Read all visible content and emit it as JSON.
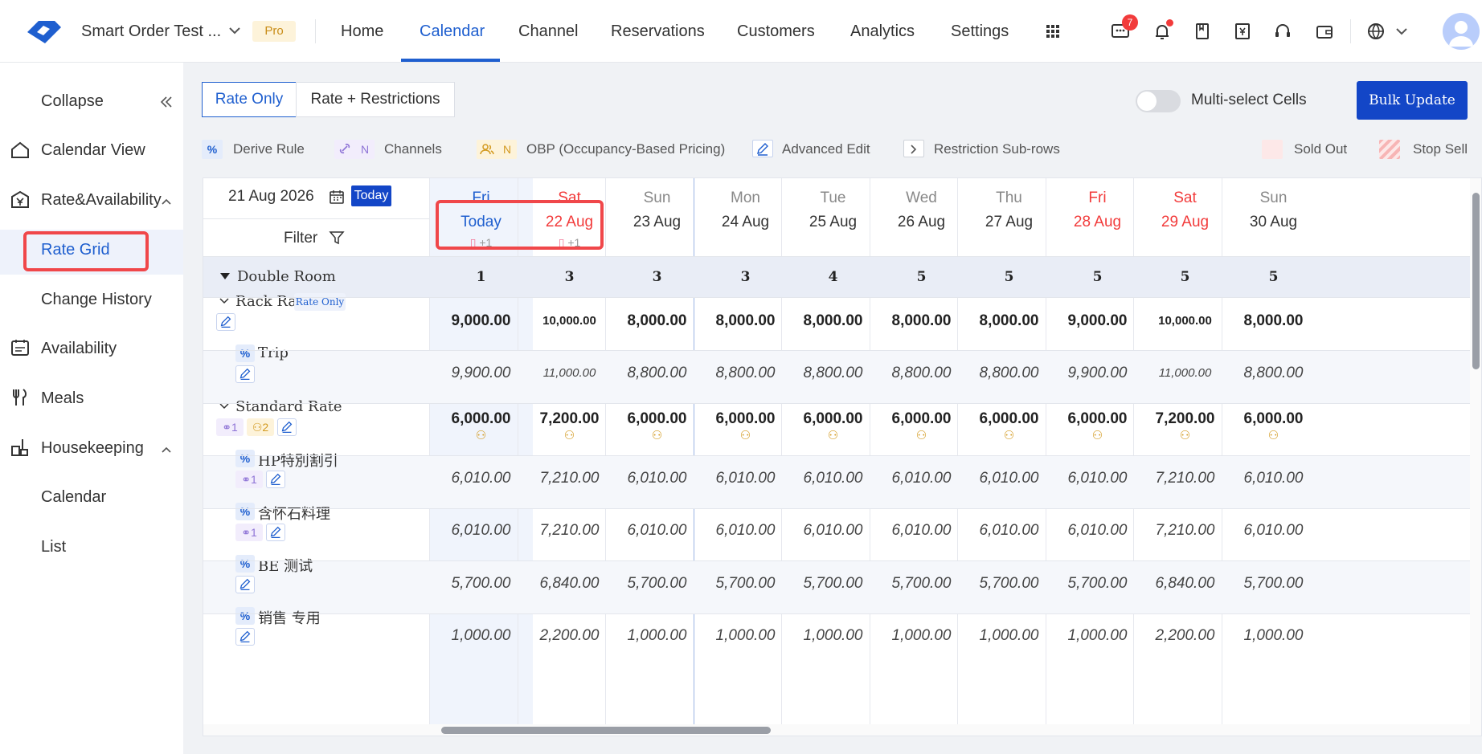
{
  "header": {
    "brand": "Smart Order Test ...",
    "badge": "Pro",
    "nav": [
      "Home",
      "Calendar",
      "Channel",
      "Reservations",
      "Customers",
      "Analytics",
      "Settings"
    ],
    "active_nav": "Calendar",
    "notification_count": "7",
    "accent": "#1f5fcf"
  },
  "sidebar": {
    "collapse": "Collapse",
    "calendar_view": "Calendar View",
    "rate_availability": "Rate&Availability",
    "rate_grid": "Rate Grid",
    "change_history": "Change History",
    "availability": "Availability",
    "meals": "Meals",
    "housekeeping": "Housekeeping",
    "hk_calendar": "Calendar",
    "hk_list": "List"
  },
  "toolbar": {
    "rate_only": "Rate Only",
    "rate_restrictions": "Rate + Restrictions",
    "multi_select": "Multi-select Cells",
    "bulk_update": "Bulk Update"
  },
  "legend": {
    "derive": "Derive Rule",
    "channels": "Channels",
    "obp": "OBP (Occupancy-Based Pricing)",
    "advanced": "Advanced Edit",
    "restriction": "Restriction Sub-rows",
    "sold_out": "Sold Out",
    "stop_sell": "Stop Sell",
    "pct": "%",
    "n": "N"
  },
  "grid_controls": {
    "date": "21 Aug 2026",
    "today": "Today",
    "filter": "Filter"
  },
  "days": [
    {
      "name": "Fri",
      "date": "Today",
      "extra": "+1"
    },
    {
      "name": "Sat",
      "date": "22 Aug",
      "extra": "+1"
    },
    {
      "name": "Sun",
      "date": "23 Aug"
    },
    {
      "name": "Mon",
      "date": "24 Aug"
    },
    {
      "name": "Tue",
      "date": "25 Aug"
    },
    {
      "name": "Wed",
      "date": "26 Aug"
    },
    {
      "name": "Thu",
      "date": "27 Aug"
    },
    {
      "name": "Fri",
      "date": "28 Aug"
    },
    {
      "name": "Sat",
      "date": "29 Aug"
    },
    {
      "name": "Sun",
      "date": "30 Aug"
    }
  ],
  "room": {
    "name": "Double Room",
    "counts": [
      "1",
      "3",
      "3",
      "3",
      "4",
      "5",
      "5",
      "5",
      "5",
      "5"
    ]
  },
  "rows": {
    "rack": {
      "name": "Rack Rate",
      "tag": "Rate Only",
      "values": [
        "9,000.00",
        "10,000.00",
        "8,000.00",
        "8,000.00",
        "8,000.00",
        "8,000.00",
        "8,000.00",
        "9,000.00",
        "10,000.00",
        "8,000.00"
      ]
    },
    "trip": {
      "name": "Trip",
      "values": [
        "9,900.00",
        "11,000.00",
        "8,800.00",
        "8,800.00",
        "8,800.00",
        "8,800.00",
        "8,800.00",
        "9,900.00",
        "11,000.00",
        "8,800.00"
      ]
    },
    "standard": {
      "name": "Standard Rate",
      "link": "1",
      "people": "2",
      "values": [
        "6,000.00",
        "7,200.00",
        "6,000.00",
        "6,000.00",
        "6,000.00",
        "6,000.00",
        "6,000.00",
        "6,000.00",
        "7,200.00",
        "6,000.00"
      ]
    },
    "hp": {
      "name": "HP特別割引",
      "link": "1",
      "values": [
        "6,010.00",
        "7,210.00",
        "6,010.00",
        "6,010.00",
        "6,010.00",
        "6,010.00",
        "6,010.00",
        "6,010.00",
        "7,210.00",
        "6,010.00"
      ]
    },
    "kaiseki": {
      "name": "含怀石料理",
      "link": "1",
      "values": [
        "6,010.00",
        "7,210.00",
        "6,010.00",
        "6,010.00",
        "6,010.00",
        "6,010.00",
        "6,010.00",
        "6,010.00",
        "7,210.00",
        "6,010.00"
      ]
    },
    "be": {
      "name": "BE 测试",
      "values": [
        "5,700.00",
        "6,840.00",
        "5,700.00",
        "5,700.00",
        "5,700.00",
        "5,700.00",
        "5,700.00",
        "5,700.00",
        "6,840.00",
        "5,700.00"
      ]
    },
    "sales": {
      "name": "销售 专用",
      "values": [
        "1,000.00",
        "2,200.00",
        "1,000.00",
        "1,000.00",
        "1,000.00",
        "1,000.00",
        "1,000.00",
        "1,000.00",
        "2,200.00",
        "1,000.00"
      ]
    }
  }
}
